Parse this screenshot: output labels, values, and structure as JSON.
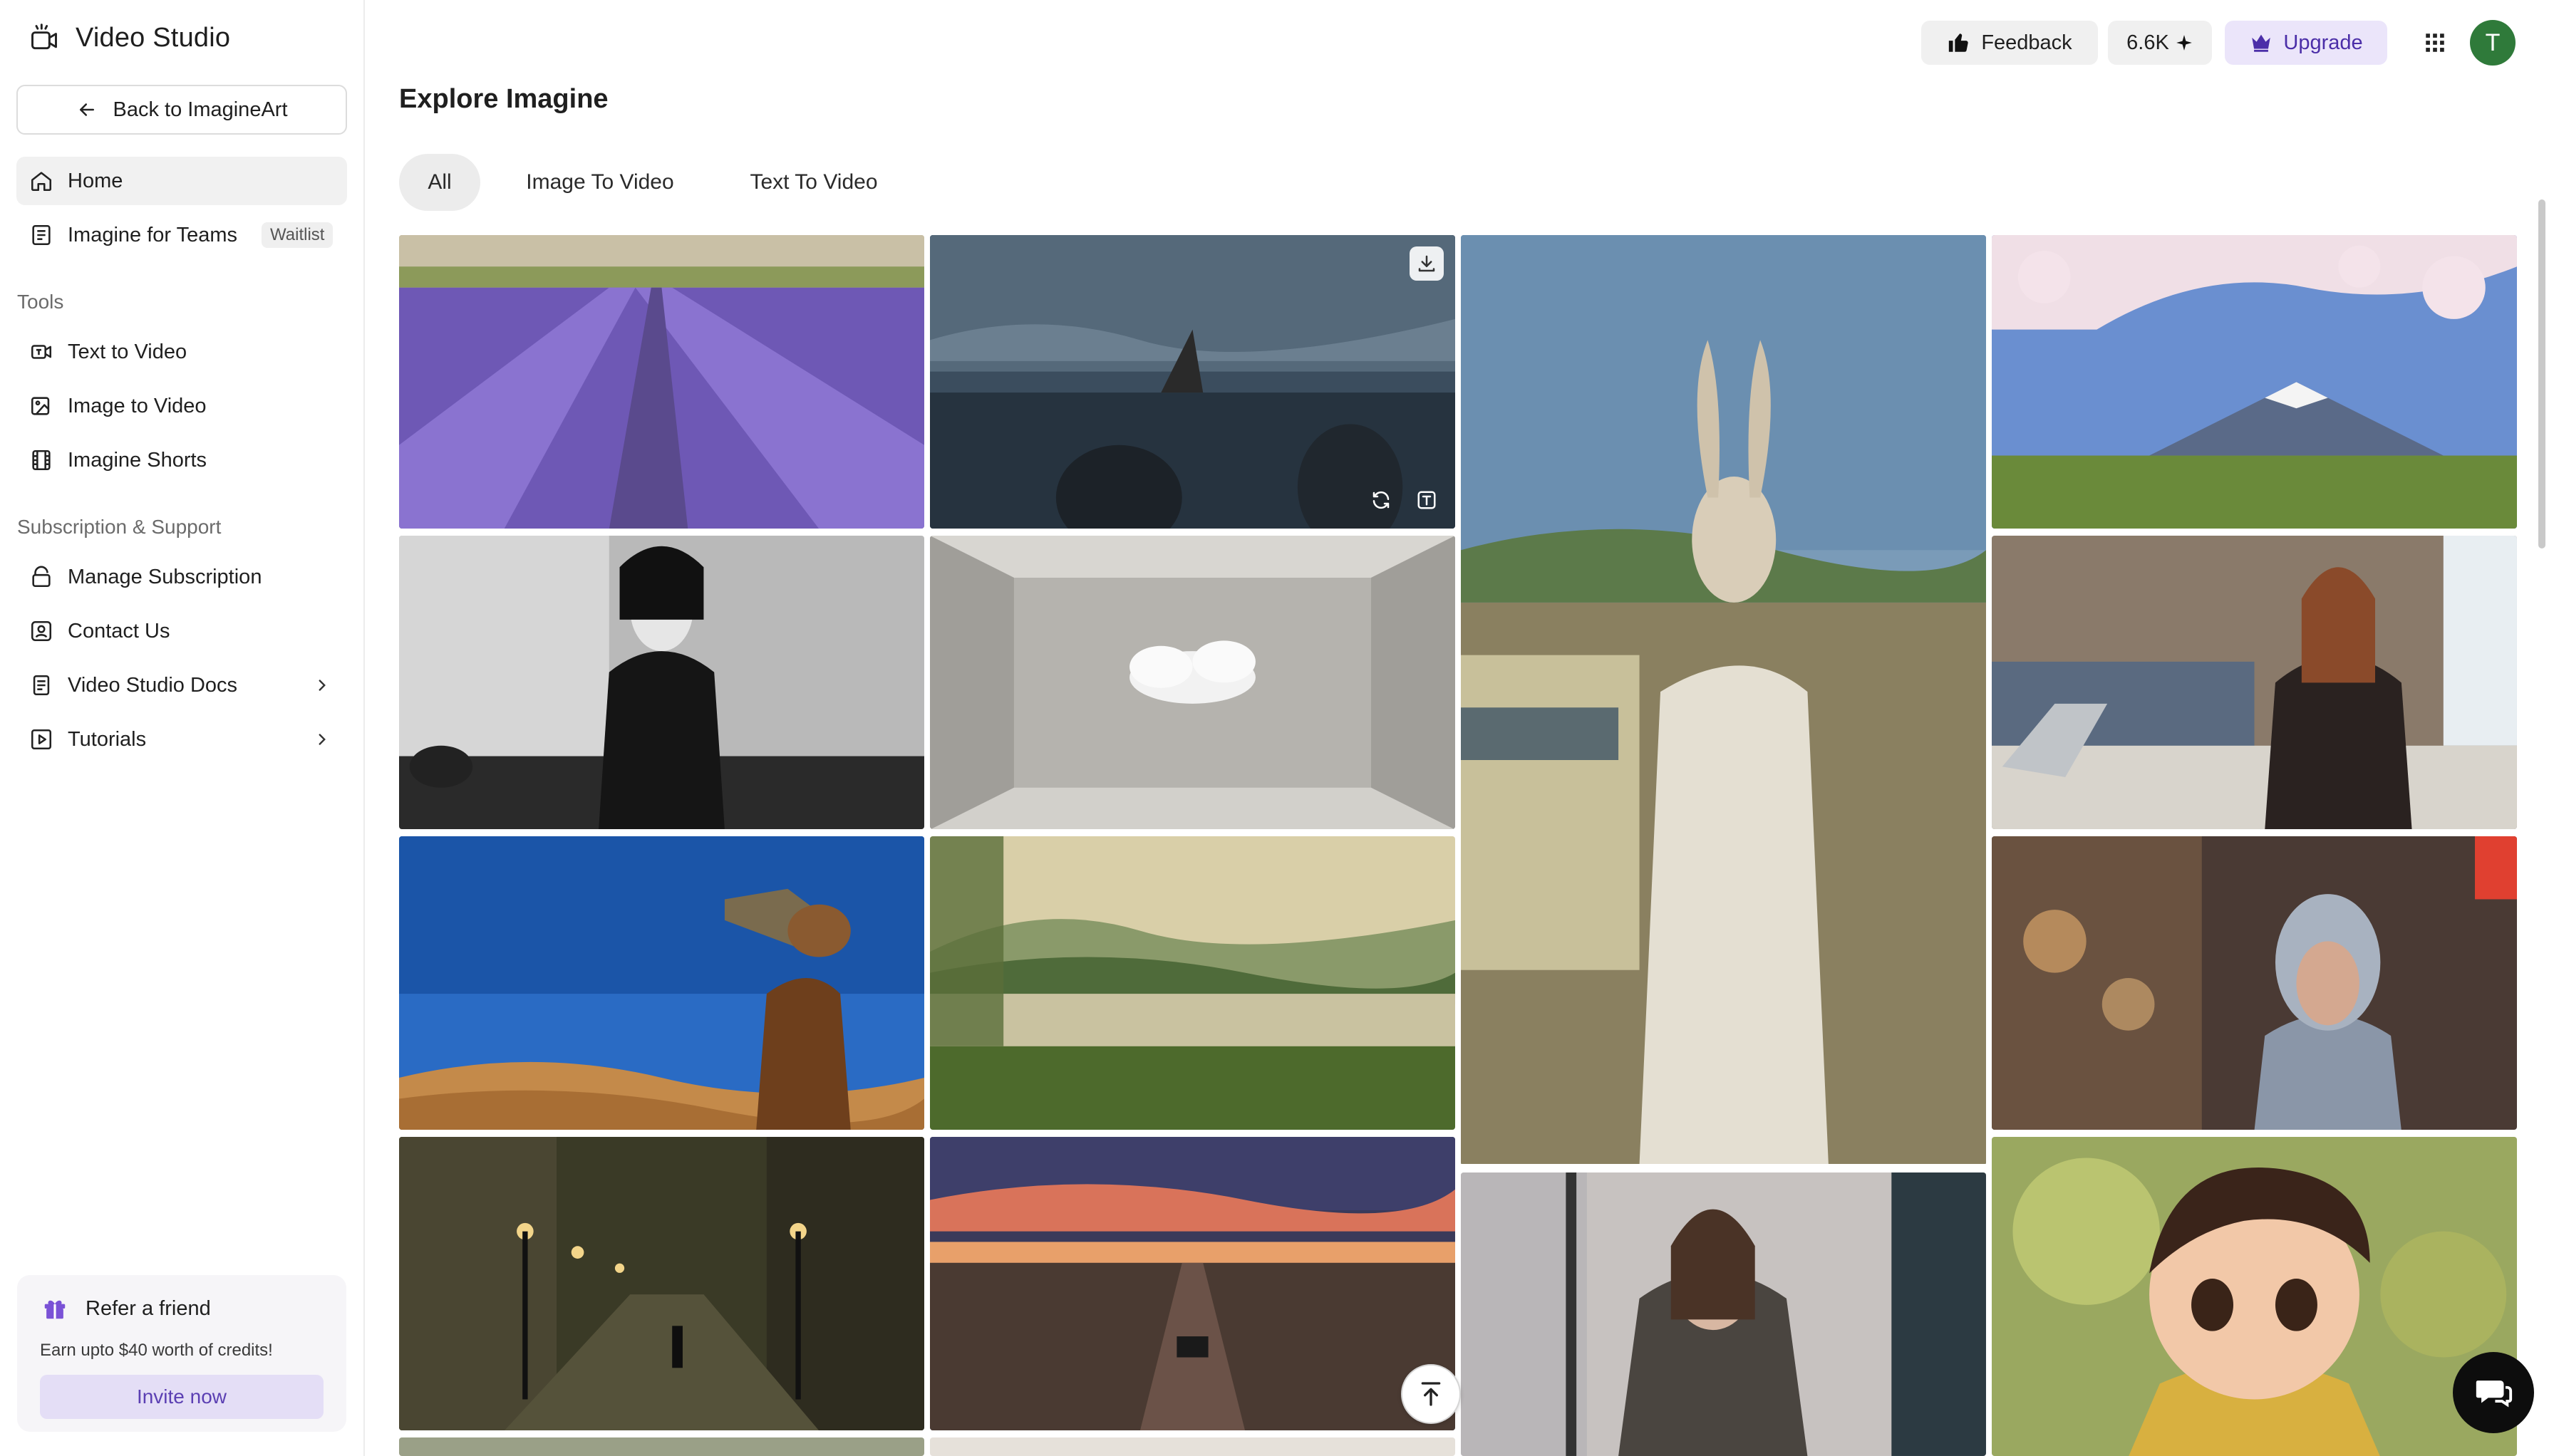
{
  "app": {
    "title": "Video Studio"
  },
  "sidebar": {
    "back_label": "Back to ImagineArt",
    "items": [
      {
        "label": "Home",
        "icon": "home-icon",
        "active": true
      },
      {
        "label": "Imagine for Teams",
        "icon": "teams-icon",
        "badge": "Waitlist"
      }
    ],
    "tools_label": "Tools",
    "tools": [
      {
        "label": "Text to Video",
        "icon": "text-to-video-icon"
      },
      {
        "label": "Image to Video",
        "icon": "image-to-video-icon"
      },
      {
        "label": "Imagine Shorts",
        "icon": "film-icon"
      }
    ],
    "support_label": "Subscription & Support",
    "support": [
      {
        "label": "Manage Subscription",
        "icon": "subscription-icon"
      },
      {
        "label": "Contact Us",
        "icon": "contact-icon"
      },
      {
        "label": "Video Studio Docs",
        "icon": "docs-icon"
      },
      {
        "label": "Tutorials",
        "icon": "tutorials-icon"
      }
    ],
    "refer": {
      "title": "Refer a friend",
      "subtitle": "Earn upto $40 worth of credits!",
      "button": "Invite now"
    }
  },
  "topbar": {
    "feedback_label": "Feedback",
    "credits_label": "6.6K",
    "upgrade_label": "Upgrade",
    "avatar_initial": "T"
  },
  "main": {
    "title": "Explore Imagine",
    "tabs": [
      {
        "label": "All",
        "active": true
      },
      {
        "label": "Image To Video"
      },
      {
        "label": "Text To Video"
      }
    ]
  },
  "colors": {
    "accent": "#5b3fb3",
    "accent_bg": "#e4def6",
    "avatar": "#2f7a3a"
  }
}
